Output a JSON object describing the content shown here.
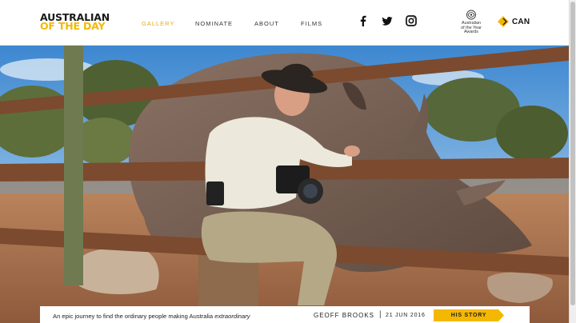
{
  "logo": {
    "line1": "AUSTRALIAN",
    "line2": "OF THE DAY"
  },
  "nav": [
    {
      "label": "GALLERY",
      "active": true
    },
    {
      "label": "NOMINATE",
      "active": false
    },
    {
      "label": "ABOUT",
      "active": false
    },
    {
      "label": "FILMS",
      "active": false
    }
  ],
  "social": [
    "facebook-icon",
    "twitter-icon",
    "instagram-icon"
  ],
  "awards": {
    "line1": "Australian",
    "line2": "of the Year",
    "line3": "Awards"
  },
  "sponsor": {
    "label": "CAN"
  },
  "caption": {
    "tagline_prefix": "An epic journey to find the ordinary people making Australia",
    "tagline_emphasis": "extraordinary",
    "person": "GEOFF BROOKS",
    "separator": "|",
    "date": "21 JUN 2016",
    "cta": "HIS STORY"
  },
  "colors": {
    "accent": "#f5b800",
    "active_nav": "#e6a817",
    "text": "#222222"
  }
}
